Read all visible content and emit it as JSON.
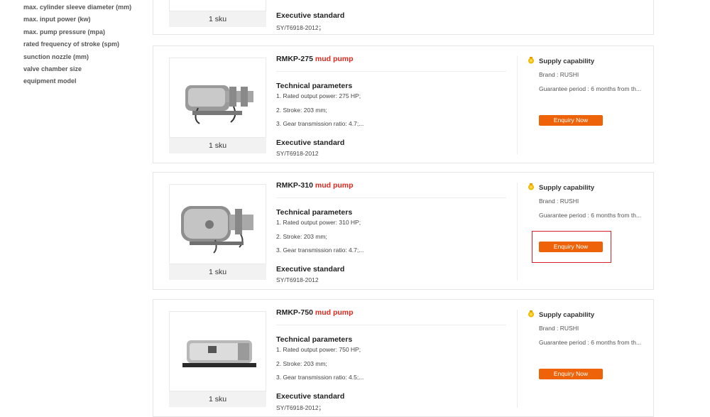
{
  "sidebar": {
    "filters": [
      "max. cylinder sleeve diameter (mm)",
      "max. input power (kw)",
      "max. pump pressure (mpa)",
      "rated frequency of stroke (spm)",
      "sunction nozzle (mm)",
      "valve chamber size",
      "equipment model"
    ]
  },
  "products": [
    {
      "sku": "1 sku",
      "std_title": "Executive standard",
      "std_value": "SY/T6918-2012；"
    },
    {
      "model": "RMKP-275",
      "type": "mud pump",
      "params_title": "Technical parameters",
      "params": [
        "1. Rated output power: 275 HP;",
        "2. Stroke: 203 mm;",
        "3. Gear transmission ratio: 4.7;..."
      ],
      "std_title": "Executive standard",
      "std_value": "SY/T6918-2012",
      "sku": "1 sku",
      "supply_title": "Supply capability",
      "brand": "Brand : RUSHI",
      "guarantee": "Guarantee period : 6 months from th...",
      "enquiry": "Enquiry Now"
    },
    {
      "model": "RMKP-310",
      "type": "mud pump",
      "params_title": "Technical parameters",
      "params": [
        "1. Rated output power: 310 HP;",
        "2. Stroke: 203 mm;",
        "3. Gear transmission ratio: 4.7;..."
      ],
      "std_title": "Executive standard",
      "std_value": "SY/T6918-2012",
      "sku": "1 sku",
      "supply_title": "Supply capability",
      "brand": "Brand : RUSHI",
      "guarantee": "Guarantee period : 6 months from th...",
      "enquiry": "Enquiry Now"
    },
    {
      "model": "RMKP-750",
      "type": "mud pump",
      "params_title": "Technical parameters",
      "params": [
        "1. Rated output power: 750 HP;",
        "2. Stroke: 203 mm;",
        "3. Gear transmission ratio: 4.5;..."
      ],
      "std_title": "Executive standard",
      "std_value": "SY/T6918-2012；",
      "sku": "1 sku",
      "supply_title": "Supply capability",
      "brand": "Brand : RUSHI",
      "guarantee": "Guarantee period : 6 months from th...",
      "enquiry": "Enquiry Now"
    }
  ],
  "colors": {
    "accent": "#ee6209",
    "highlight": "#d8202a",
    "type_text": "#e0281d",
    "medal": "#f2b705"
  },
  "icons": {
    "medal": "medal-icon",
    "pump": "mud-pump-image"
  }
}
